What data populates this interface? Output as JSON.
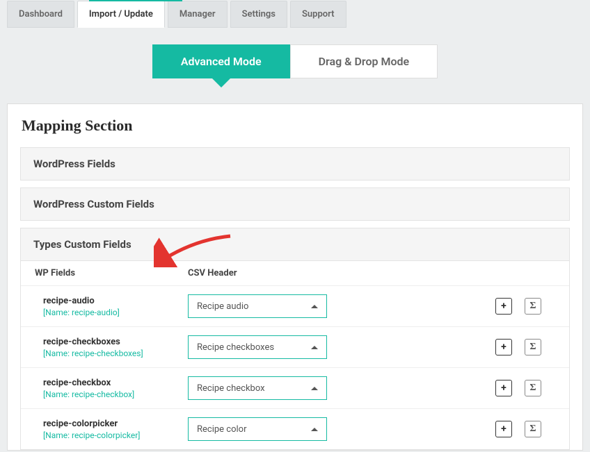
{
  "tabs": [
    "Dashboard",
    "Import / Update",
    "Manager",
    "Settings",
    "Support"
  ],
  "activeTabIndex": 1,
  "modes": {
    "advanced": "Advanced Mode",
    "drag": "Drag & Drop Mode"
  },
  "pageTitle": "Mapping Section",
  "sections": {
    "wpFields": "WordPress Fields",
    "wpCustom": "WordPress Custom Fields",
    "types": "Types Custom Fields"
  },
  "columns": {
    "wp": "WP Fields",
    "csv": "CSV Header"
  },
  "rows": [
    {
      "field": "recipe-audio",
      "name": "[Name: recipe-audio]",
      "csv": "Recipe audio"
    },
    {
      "field": "recipe-checkboxes",
      "name": "[Name: recipe-checkboxes]",
      "csv": "Recipe checkboxes"
    },
    {
      "field": "recipe-checkbox",
      "name": "[Name: recipe-checkbox]",
      "csv": "Recipe checkbox"
    },
    {
      "field": "recipe-colorpicker",
      "name": "[Name: recipe-colorpicker]",
      "csv": "Recipe color"
    }
  ],
  "icons": {
    "plus": "+",
    "sigma": "Σ"
  }
}
